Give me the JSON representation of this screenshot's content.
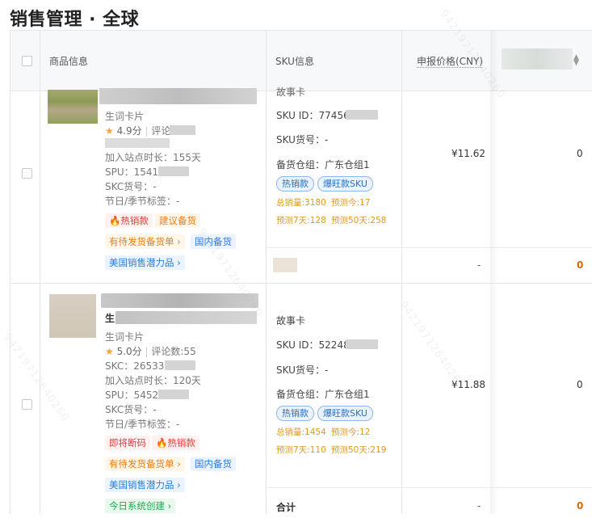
{
  "page_title": "销售管理 · 全球",
  "table": {
    "headers": {
      "product": "商品信息",
      "sku": "SKU信息",
      "price": "申报价格(CNY)",
      "sort_icon": "sort-icon"
    },
    "rows": [
      {
        "product": {
          "subtitle": "生词卡片",
          "rating": "4.9分",
          "review_label": "评论",
          "onsite_time": "加入站点时长：155天",
          "spu": "SPU：1541",
          "skc": "SKC货号：-",
          "festival": "节日/季节标签：-",
          "tags_row1": [
            "热销款",
            "建议备货"
          ],
          "tags_row2": [
            "有待发货备货单",
            "国内备货"
          ],
          "tags_row3": [
            "美国销售潜力品"
          ]
        },
        "sku": {
          "top_text": "故事卡",
          "sku_id": "SKU ID：774568",
          "sku_code": "SKU货号：-",
          "warehouse": "备货仓组：广东仓组1",
          "pills": [
            "热销款",
            "爆旺款SKU"
          ],
          "stat_total": "总销量:3180",
          "stat_today": "预测今:17",
          "stat_7d": "预测7天:128",
          "stat_50d": "预测50天:258"
        },
        "price": "¥11.62",
        "value": "0",
        "sub_price": "-",
        "sub_value": "0"
      },
      {
        "product": {
          "title_prefix": "生",
          "subtitle": "生词卡片",
          "rating": "5.0分",
          "review_label": "评论数:55",
          "skc_id": "SKC：26533",
          "onsite_time": "加入站点时长：120天",
          "spu": "SPU：5452",
          "skc": "SKC货号：-",
          "festival": "节日/季节标签：-",
          "tags_row1": [
            "即将断码",
            "热销款"
          ],
          "tags_row2": [
            "有待发货备货单",
            "国内备货"
          ],
          "tags_row3": [
            "美国销售潜力品"
          ],
          "tags_row4": [
            "今日系统创建"
          ]
        },
        "sku": {
          "top_text": "故事卡",
          "sku_id": "SKU ID：522484",
          "sku_code": "SKU货号：-",
          "warehouse": "备货仓组：广东仓组1",
          "pills": [
            "热销款",
            "爆旺款SKU"
          ],
          "stat_total": "总销量:1454",
          "stat_today": "预测今:12",
          "stat_7d": "预测7天:110",
          "stat_50d": "预测50天:219"
        },
        "price": "¥11.88",
        "value": "0",
        "total_label": "合计",
        "sub_price": "-",
        "sub_value": "0"
      }
    ]
  },
  "colors": {
    "hot_red": "#e23c39",
    "orange": "#f07d17",
    "blue": "#2e7bd9",
    "green": "#1fa84e",
    "stat": "#e09a1c"
  }
}
